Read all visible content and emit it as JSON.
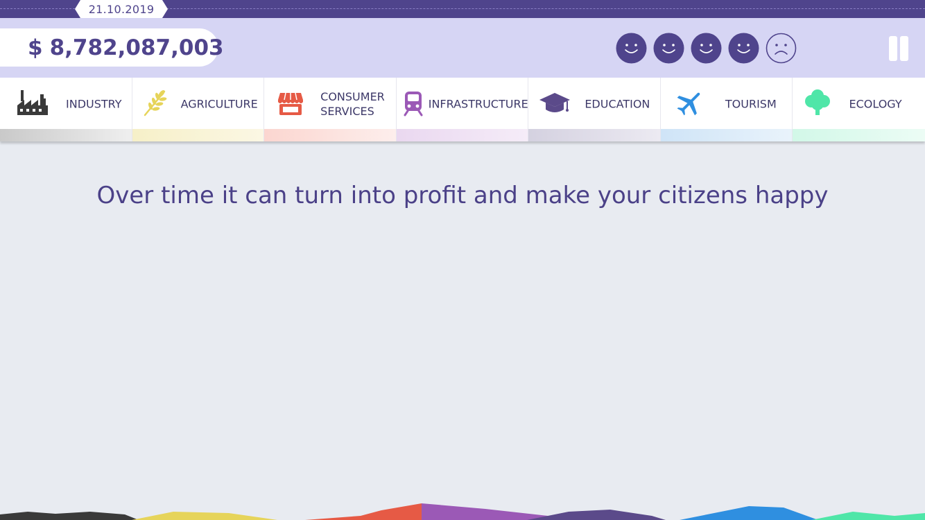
{
  "header": {
    "date": "21.10.2019",
    "money_currency": "$",
    "money_value": "8,782,087,003"
  },
  "happiness": [
    "happy",
    "happy",
    "happy",
    "happy",
    "sad"
  ],
  "tabs": [
    {
      "label": "INDUSTRY",
      "icon": "factory-icon",
      "color": "#3a3a3a"
    },
    {
      "label": "AGRICULTURE",
      "icon": "wheat-icon",
      "color": "#e6d45a"
    },
    {
      "label": "CONSUMER\nSERVICES",
      "icon": "shop-icon",
      "color": "#e65a45"
    },
    {
      "label": "INFRASTRUCTURE",
      "icon": "train-icon",
      "color": "#9b59b6"
    },
    {
      "label": "EDUCATION",
      "icon": "graduation-cap-icon",
      "color": "#5b4a8a"
    },
    {
      "label": "TOURISM",
      "icon": "airplane-icon",
      "color": "#2f8fe0"
    },
    {
      "label": "ECOLOGY",
      "icon": "tree-icon",
      "color": "#4fe6a8"
    }
  ],
  "message": "Over time it can turn into profit and make your citizens happy",
  "colors": {
    "topbar": "#4f448c",
    "hud": "#d6d5f4",
    "text": "#4f448c",
    "background": "#e8ebf1"
  }
}
